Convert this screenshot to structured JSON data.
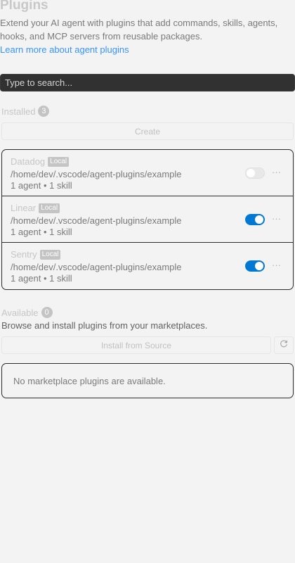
{
  "header": {
    "title": "Plugins",
    "description": "Extend your AI agent with plugins that add commands, skills, agents, hooks, and MCP servers from reusable packages.",
    "learn_more": "Learn more about agent plugins"
  },
  "search": {
    "placeholder": "Type to search..."
  },
  "installed": {
    "label": "Installed",
    "count": "3",
    "create_label": "Create",
    "plugins": [
      {
        "name": "Datadog",
        "badge": "Local",
        "path": "/home/dev/.vscode/agent-plugins/example",
        "meta": "1 agent • 1 skill",
        "enabled": false,
        "more": "···"
      },
      {
        "name": "Linear",
        "badge": "Local",
        "path": "/home/dev/.vscode/agent-plugins/example",
        "meta": "1 agent • 1 skill",
        "enabled": true,
        "more": "···"
      },
      {
        "name": "Sentry",
        "badge": "Local",
        "path": "/home/dev/.vscode/agent-plugins/example",
        "meta": "1 agent • 1 skill",
        "enabled": true,
        "more": "···"
      }
    ]
  },
  "available": {
    "label": "Available",
    "count": "0",
    "description": "Browse and install plugins from your marketplaces.",
    "install_label": "Install from Source",
    "refresh_icon": "refresh-icon",
    "empty_text": "No marketplace plugins are available."
  },
  "colors": {
    "accent": "#0078d4",
    "link": "#3794ff",
    "background": "#f3f3f3",
    "search_bg": "#313131"
  }
}
